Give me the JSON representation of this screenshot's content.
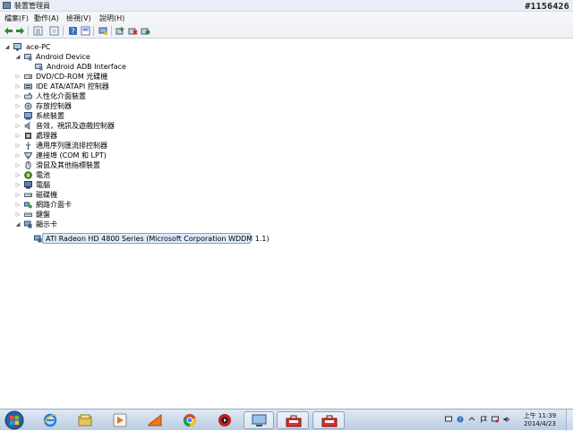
{
  "window": {
    "title": "裝置管理員",
    "watermark": "#1156426"
  },
  "menu": [
    "檔案(F)",
    "動作(A)",
    "檢視(V)",
    "說明(H)"
  ],
  "toolbar": {
    "buttons": [
      "back-icon",
      "forward-icon",
      "properties-grid-icon",
      "list-icon",
      "help-icon",
      "view-icon",
      "computer-scan-icon",
      "update-driver-icon",
      "uninstall-icon",
      "enable-icon"
    ]
  },
  "tree": {
    "root": "ace-PC",
    "items": [
      {
        "label": "Android Device",
        "expanded": true,
        "icon": "android-device-icon"
      },
      {
        "label": "Android ADB Interface",
        "child": true,
        "icon": "adb-interface-icon"
      },
      {
        "label": "DVD/CD-ROM 光碟機",
        "icon": "dvd-drive-icon"
      },
      {
        "label": "IDE ATA/ATAPI 控制器",
        "icon": "ide-controller-icon"
      },
      {
        "label": "人性化介面裝置",
        "icon": "hid-icon"
      },
      {
        "label": "存放控制器",
        "icon": "storage-controller-icon"
      },
      {
        "label": "系統裝置",
        "icon": "system-device-icon"
      },
      {
        "label": "音效，視訊及遊戲控制器",
        "icon": "sound-icon"
      },
      {
        "label": "處理器",
        "icon": "processor-icon"
      },
      {
        "label": "通用序列匯流排控制器",
        "icon": "usb-icon"
      },
      {
        "label": "連接埠 (COM 和 LPT)",
        "icon": "port-icon"
      },
      {
        "label": "滑鼠及其他指標裝置",
        "icon": "mouse-icon"
      },
      {
        "label": "電池",
        "icon": "battery-icon"
      },
      {
        "label": "電腦",
        "icon": "computer-icon"
      },
      {
        "label": "磁碟機",
        "icon": "disk-drive-icon"
      },
      {
        "label": "網路介面卡",
        "icon": "network-adapter-icon"
      },
      {
        "label": "鍵盤",
        "icon": "keyboard-icon"
      },
      {
        "label": "顯示卡",
        "expanded": true,
        "icon": "display-adapter-icon"
      },
      {
        "label": "ATI Radeon HD 4800 Series (Microsoft Corporation WDDM 1.1)",
        "child": true,
        "selected": true,
        "icon": "display-adapter-device-icon"
      }
    ]
  },
  "taskbar": {
    "apps": [
      "start-orb-icon",
      "internet-explorer-icon",
      "file-explorer-icon",
      "media-player-icon",
      "app-orange-icon",
      "chrome-icon",
      "media-app-icon",
      "device-manager-icon",
      "toolbox-icon-1",
      "toolbox-icon-2"
    ],
    "clock_time": "上午 11:39",
    "clock_date": "2014/4/23"
  }
}
